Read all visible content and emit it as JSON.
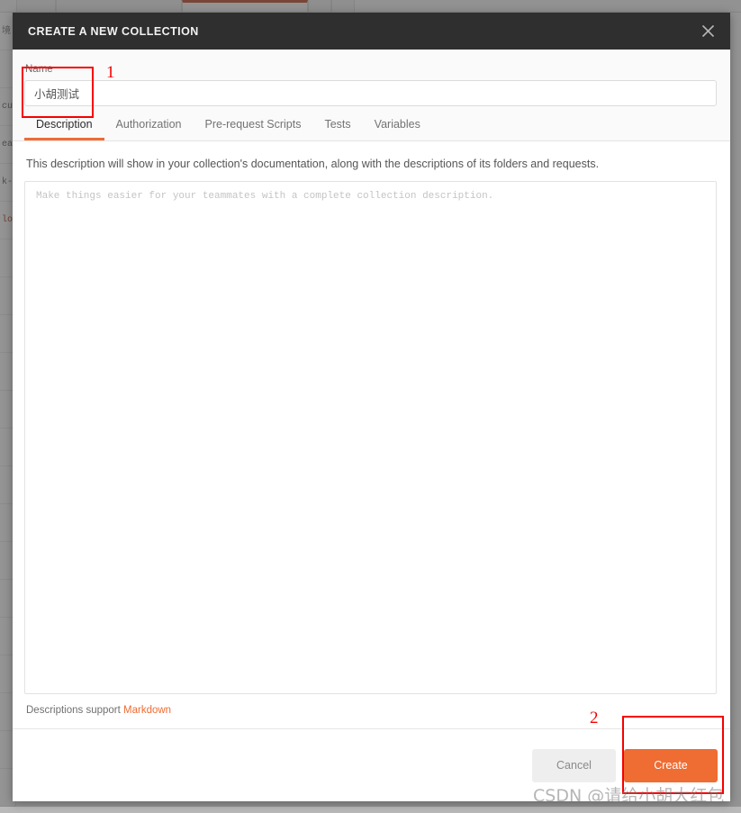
{
  "background": {
    "sidebar_fragments": [
      "境",
      "cuu",
      "ea",
      "k-w",
      "lo"
    ]
  },
  "modal": {
    "title": "CREATE A NEW COLLECTION",
    "close_icon": "close-icon",
    "name": {
      "label": "Name",
      "value": "小胡测试",
      "placeholder": ""
    },
    "tabs": [
      {
        "label": "Description",
        "active": true
      },
      {
        "label": "Authorization",
        "active": false
      },
      {
        "label": "Pre-request Scripts",
        "active": false
      },
      {
        "label": "Tests",
        "active": false
      },
      {
        "label": "Variables",
        "active": false
      }
    ],
    "description": {
      "help_text": "This description will show in your collection's documentation, along with the descriptions of its folders and requests.",
      "placeholder": "Make things easier for your teammates with a complete collection description.",
      "value": "",
      "markdown_note_prefix": "Descriptions support ",
      "markdown_link_label": "Markdown"
    },
    "footer": {
      "cancel_label": "Cancel",
      "create_label": "Create"
    }
  },
  "annotations": [
    {
      "number": "1",
      "target": "name-input"
    },
    {
      "number": "2",
      "target": "create-button"
    }
  ],
  "watermark": "CSDN @请给小胡大红包",
  "colors": {
    "accent": "#ef6c33",
    "header_bg": "#2f2f2f",
    "annotation_red": "#f70000",
    "cancel_bg": "#eeeeee"
  }
}
